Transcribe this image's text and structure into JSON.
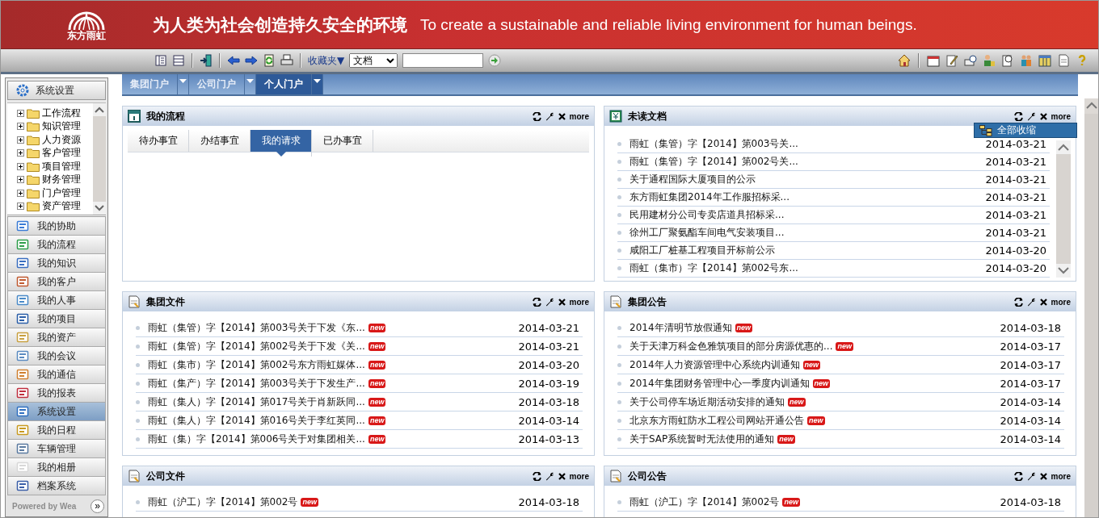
{
  "header": {
    "logo_text": "东方雨虹",
    "slogan_cn": "为人类为社会创造持久安全的环境",
    "slogan_en": "To create a sustainable and reliable living environment for human beings."
  },
  "toolbar": {
    "favorites": "收藏夹▼",
    "search_scope": "文档"
  },
  "sidebar": {
    "top_button": "系统设置",
    "tree": [
      {
        "label": "工作流程",
        "expanded": false
      },
      {
        "label": "知识管理",
        "expanded": false
      },
      {
        "label": "人力资源",
        "expanded": false
      },
      {
        "label": "客户管理",
        "expanded": false
      },
      {
        "label": "项目管理",
        "expanded": false
      },
      {
        "label": "财务管理",
        "expanded": false
      },
      {
        "label": "门户管理",
        "expanded": false
      },
      {
        "label": "资产管理",
        "expanded": false
      }
    ],
    "nav": [
      {
        "label": "我的协助",
        "selected": false
      },
      {
        "label": "我的流程",
        "selected": false
      },
      {
        "label": "我的知识",
        "selected": false
      },
      {
        "label": "我的客户",
        "selected": false
      },
      {
        "label": "我的人事",
        "selected": false
      },
      {
        "label": "我的项目",
        "selected": false
      },
      {
        "label": "我的资产",
        "selected": false
      },
      {
        "label": "我的会议",
        "selected": false
      },
      {
        "label": "我的通信",
        "selected": false
      },
      {
        "label": "我的报表",
        "selected": false
      },
      {
        "label": "系统设置",
        "selected": true
      },
      {
        "label": "我的日程",
        "selected": false
      },
      {
        "label": "车辆管理",
        "selected": false
      },
      {
        "label": "我的相册",
        "selected": false
      },
      {
        "label": "档案系统",
        "selected": false
      }
    ],
    "footer": "Powered by Wea",
    "expand_button": "»"
  },
  "portal_tabs": [
    {
      "label": "集团门户",
      "selected": false
    },
    {
      "label": "公司门户",
      "selected": false
    },
    {
      "label": "个人门户",
      "selected": true
    }
  ],
  "context_menu": {
    "label": "全部收缩"
  },
  "panels": [
    {
      "title": "我的流程",
      "kind": "tabs",
      "more": "more",
      "tabs": [
        {
          "label": "待办事宜",
          "selected": false
        },
        {
          "label": "办结事宜",
          "selected": false
        },
        {
          "label": "我的请求",
          "selected": true
        },
        {
          "label": "已办事宜",
          "selected": false
        }
      ]
    },
    {
      "title": "未读文档",
      "kind": "scroll-list",
      "more": "more",
      "items": [
        {
          "title": "雨虹（集管）字【2014】第003号关...",
          "date": "2014-03-21"
        },
        {
          "title": "雨虹（集管）字【2014】第002号关...",
          "date": "2014-03-21"
        },
        {
          "title": "关于通程国际大厦项目的公示",
          "date": "2014-03-21"
        },
        {
          "title": "东方雨虹集团2014年工作服招标采...",
          "date": "2014-03-21"
        },
        {
          "title": "民用建材分公司专卖店道具招标采...",
          "date": "2014-03-21"
        },
        {
          "title": "徐州工厂聚氨酯车间电气安装项目...",
          "date": "2014-03-21"
        },
        {
          "title": "咸阳工厂桩基工程项目开标前公示",
          "date": "2014-03-20"
        },
        {
          "title": "雨虹（集市）字【2014】第002号东...",
          "date": "2014-03-20"
        }
      ]
    },
    {
      "title": "集团文件",
      "kind": "list",
      "more": "more",
      "items": [
        {
          "title": "雨虹（集管）字【2014】第003号关于下发《东...",
          "badge": "new",
          "date": "2014-03-21"
        },
        {
          "title": "雨虹（集管）字【2014】第002号关于下发《关...",
          "badge": "new",
          "date": "2014-03-21"
        },
        {
          "title": "雨虹（集市）字【2014】第002号东方雨虹媒体...",
          "badge": "new",
          "date": "2014-03-20"
        },
        {
          "title": "雨虹（集产）字【2014】第003号关于下发生产...",
          "badge": "new",
          "date": "2014-03-19"
        },
        {
          "title": "雨虹（集人）字【2014】第017号关于肖新跃同...",
          "badge": "new",
          "date": "2014-03-18"
        },
        {
          "title": "雨虹（集人）字【2014】第016号关于李红英同...",
          "badge": "new",
          "date": "2014-03-14"
        },
        {
          "title": "雨虹（集）字【2014】第006号关于对集团相关...",
          "badge": "new",
          "date": "2014-03-13"
        }
      ]
    },
    {
      "title": "集团公告",
      "kind": "list",
      "more": "more",
      "items": [
        {
          "title": "2014年清明节放假通知",
          "badge": "new",
          "date": "2014-03-18"
        },
        {
          "title": "关于天津万科金色雅筑项目的部分房源优惠的...",
          "badge": "new",
          "date": "2014-03-17"
        },
        {
          "title": "2014年人力资源管理中心系统内训通知",
          "badge": "new",
          "date": "2014-03-17"
        },
        {
          "title": "2014年集团财务管理中心一季度内训通知",
          "badge": "new",
          "date": "2014-03-17"
        },
        {
          "title": "关于公司停车场近期活动安排的通知",
          "badge": "new",
          "date": "2014-03-14"
        },
        {
          "title": "北京东方雨虹防水工程公司网站开通公告",
          "badge": "new",
          "date": "2014-03-14"
        },
        {
          "title": "关于SAP系统暂时无法使用的通知",
          "badge": "new",
          "date": "2014-03-14"
        }
      ]
    },
    {
      "title": "公司文件",
      "kind": "list",
      "more": "more",
      "items": [
        {
          "title": "雨虹（沪工）字【2014】第002号",
          "badge": "new",
          "date": "2014-03-18"
        }
      ]
    },
    {
      "title": "公司公告",
      "kind": "list",
      "more": "more",
      "items": [
        {
          "title": "雨虹（沪工）字【2014】第002号",
          "badge": "new",
          "date": "2014-03-18"
        }
      ]
    }
  ]
}
